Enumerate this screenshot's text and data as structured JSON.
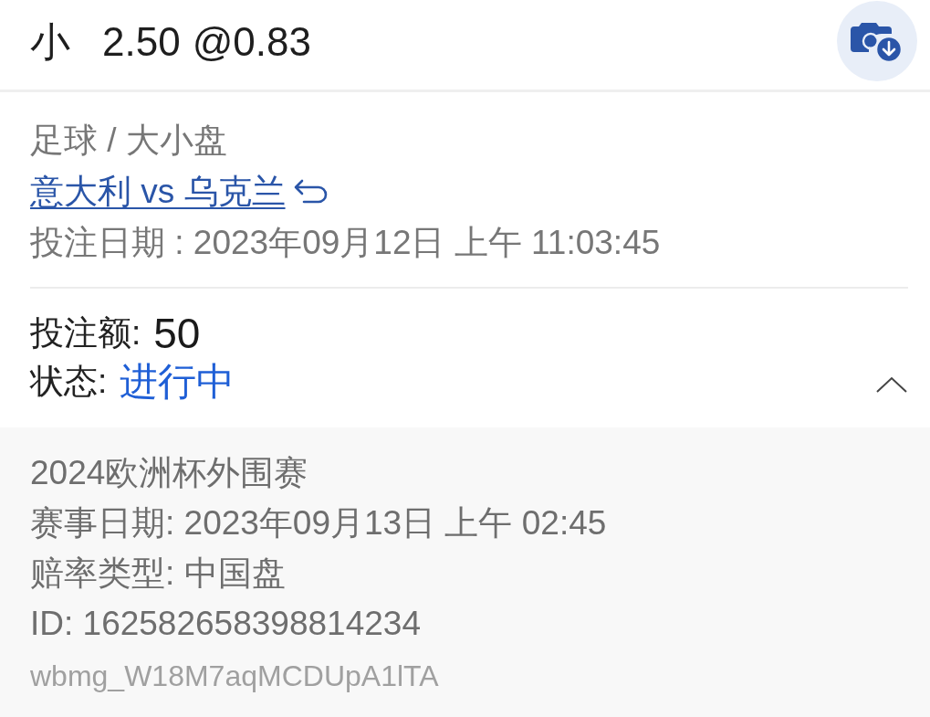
{
  "header": {
    "selection": "小",
    "line": "2.50",
    "odds": "@0.83"
  },
  "bet": {
    "category": "足球 / 大小盘",
    "match": "意大利 vs 乌克兰",
    "bet_date": "投注日期 : 2023年09月12日 上午 11:03:45"
  },
  "stake": {
    "label": "投注额:",
    "value": "50"
  },
  "status": {
    "label": "状态:",
    "value": "进行中",
    "expanded": true
  },
  "details": {
    "lines": [
      "2024欧洲杯外围赛",
      "赛事日期: 2023年09月13日 上午 02:45",
      "赔率类型: 中国盘",
      "ID: 162582658398814234"
    ],
    "reference": "wbmg_W18M7aqMCDUpA1lTA"
  }
}
